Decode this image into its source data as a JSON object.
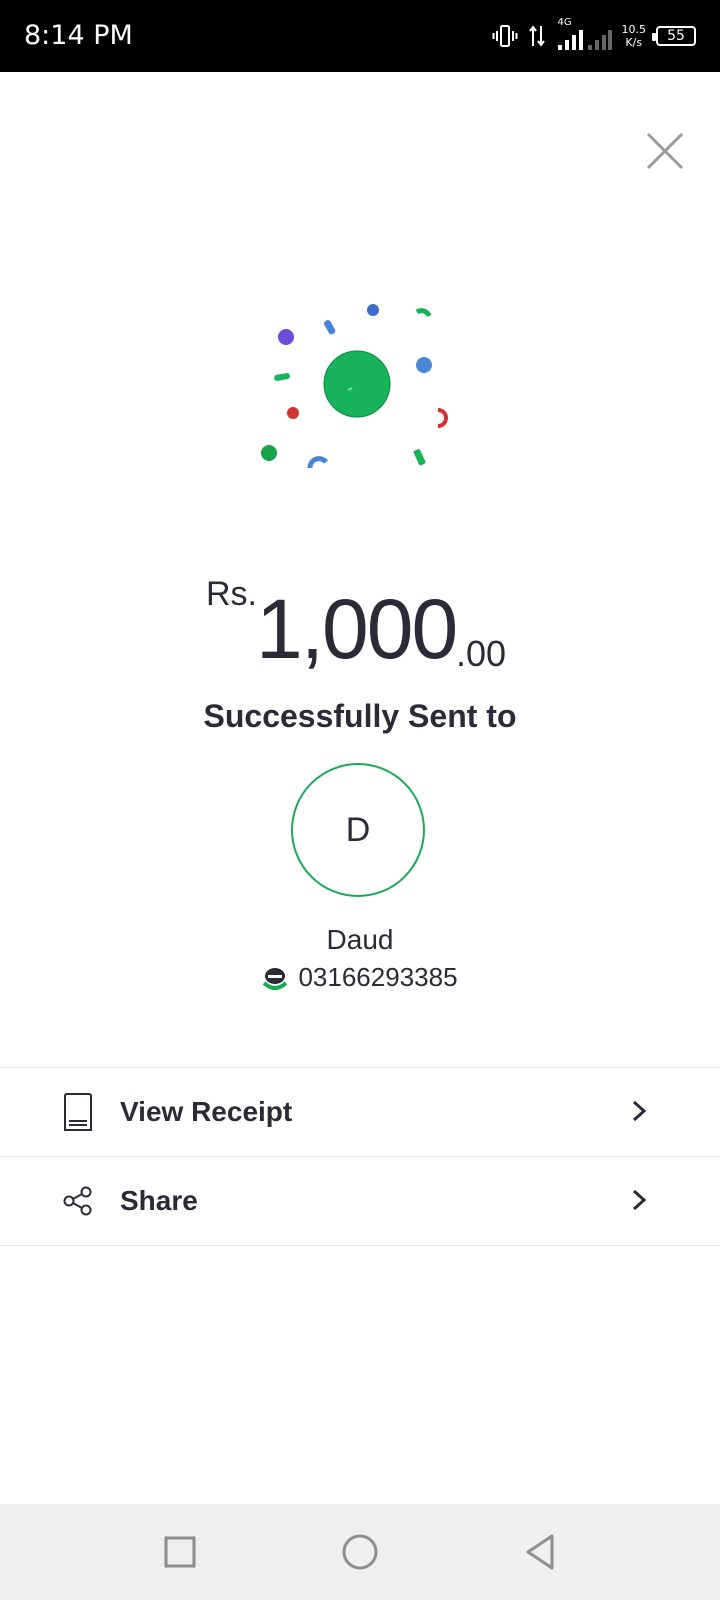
{
  "status_bar": {
    "time": "8:14 PM",
    "speed_value": "10.5",
    "speed_unit": "K/s",
    "network": "4G",
    "battery": "55"
  },
  "transaction": {
    "currency": "Rs.",
    "amount_major": "1,000",
    "amount_minor": ".00",
    "status_text": "Successfully Sent to"
  },
  "recipient": {
    "initial": "D",
    "name": "Daud",
    "phone": "03166293385"
  },
  "actions": [
    {
      "label": "View Receipt",
      "icon": "receipt-icon"
    },
    {
      "label": "Share",
      "icon": "share-icon"
    }
  ],
  "colors": {
    "accent": "#1aaa55",
    "text": "#2b2a36",
    "nav_bg": "#efefef"
  }
}
